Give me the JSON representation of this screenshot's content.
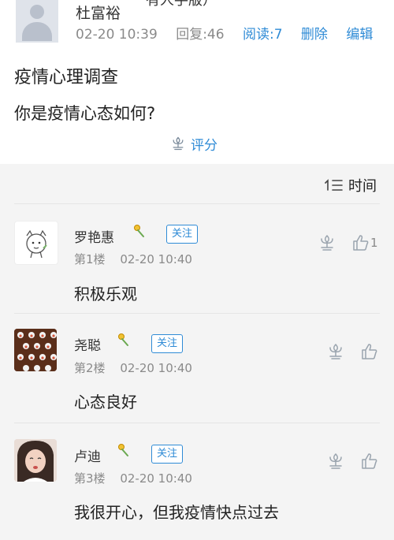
{
  "post": {
    "top_fragment": "有人手版）",
    "author_name": "杜富裕",
    "date": "02-20 10:39",
    "reply_count": "回复:46",
    "read_count": "阅读:7",
    "delete_label": "删除",
    "edit_label": "编辑",
    "title": "疫情心理调查",
    "question": "你是疫情心态如何?",
    "rate_label": "评分"
  },
  "sort": {
    "label": "时间"
  },
  "replies": [
    {
      "name": "罗艳惠",
      "follow": "关注",
      "floor": "第1楼",
      "date": "02-20 10:40",
      "content": "积极乐观",
      "likes": "1"
    },
    {
      "name": "尧聪",
      "follow": "关注",
      "floor": "第2楼",
      "date": "02-20 10:40",
      "content": "心态良好",
      "likes": ""
    },
    {
      "name": "卢迪",
      "follow": "关注",
      "floor": "第3楼",
      "date": "02-20 10:40",
      "content": "我很开心，但我疫情快点过去",
      "likes": ""
    }
  ],
  "colors": {
    "accent": "#2f8bd6",
    "meta_gray": "#8a8a8a",
    "panel_bg": "#f4f4f4"
  }
}
